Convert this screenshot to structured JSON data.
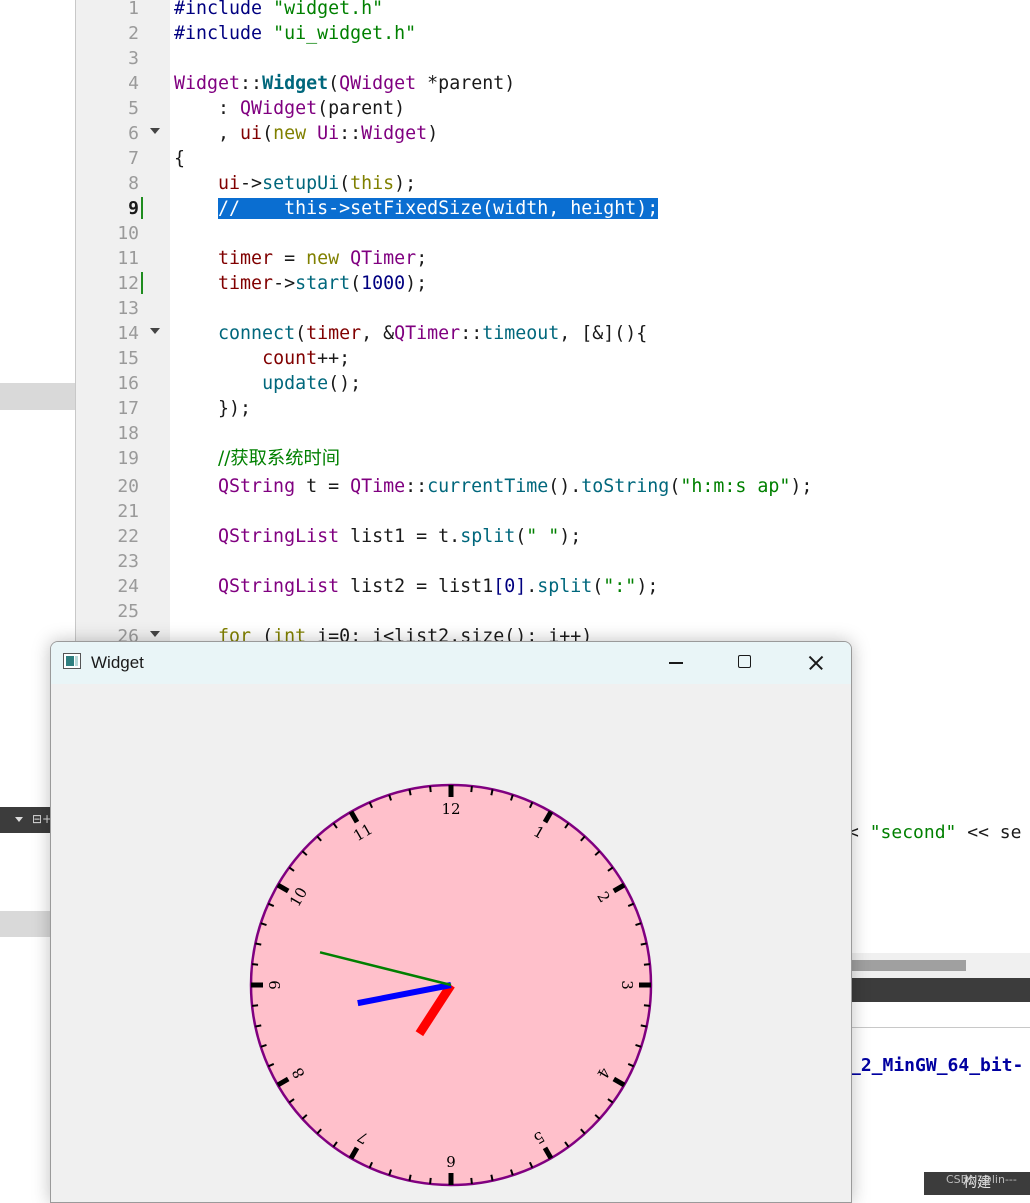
{
  "editor": {
    "lines": [
      {
        "n": "1"
      },
      {
        "n": "2"
      },
      {
        "n": "3"
      },
      {
        "n": "4"
      },
      {
        "n": "5"
      },
      {
        "n": "6"
      },
      {
        "n": "7"
      },
      {
        "n": "8"
      },
      {
        "n": "9"
      },
      {
        "n": "10"
      },
      {
        "n": "11"
      },
      {
        "n": "12"
      },
      {
        "n": "13"
      },
      {
        "n": "14"
      },
      {
        "n": "15"
      },
      {
        "n": "16"
      },
      {
        "n": "17"
      },
      {
        "n": "18"
      },
      {
        "n": "19"
      },
      {
        "n": "20"
      },
      {
        "n": "21"
      },
      {
        "n": "22"
      },
      {
        "n": "23"
      },
      {
        "n": "24"
      },
      {
        "n": "25"
      },
      {
        "n": "26"
      }
    ],
    "code": {
      "l1_pp": "#include ",
      "l1_str": "\"widget.h\"",
      "l2_pp": "#include ",
      "l2_str": "\"ui_widget.h\"",
      "l4_ty": "Widget",
      "l4_sep": "::",
      "l4_fn": "Widget",
      "l4_open": "(",
      "l4_ty2": "QWidget",
      "l4_rest": " *parent)",
      "l5_pre": "    : ",
      "l5_ty": "QWidget",
      "l5_rest": "(parent)",
      "l6_pre": "    , ",
      "l6_var": "ui",
      "l6_open": "(",
      "l6_kw": "new",
      "l6_sp": " ",
      "l6_ty": "Ui",
      "l6_sep": "::",
      "l6_ty2": "Widget",
      "l6_close": ")",
      "l7": "{",
      "l8_pre": "    ",
      "l8_var": "ui",
      "l8_arrow": "->",
      "l8_fn": "setupUi",
      "l8_open": "(",
      "l8_kw": "this",
      "l8_close": ");",
      "l9_pre": "    ",
      "l9_sel": "//    this->setFixedSize(width, height);",
      "l11_pre": "    ",
      "l11_var": "timer",
      "l11_eq": " = ",
      "l11_kw": "new",
      "l11_sp": " ",
      "l11_ty": "QTimer",
      "l11_end": ";",
      "l12_pre": "    ",
      "l12_var": "timer",
      "l12_arrow": "->",
      "l12_fn": "start",
      "l12_open": "(",
      "l12_num": "1000",
      "l12_close": ");",
      "l14_pre": "    ",
      "l14_fn": "connect",
      "l14_open": "(",
      "l14_var": "timer",
      "l14_c": ", &",
      "l14_ty": "QTimer",
      "l14_sep": "::",
      "l14_fn2": "timeout",
      "l14_rest": ", [&](){",
      "l15_pre": "        ",
      "l15_var": "count",
      "l15_rest": "++;",
      "l16_pre": "        ",
      "l16_fn": "update",
      "l16_rest": "();",
      "l17": "    });",
      "l19_pre": "    ",
      "l19_cm": "//获取系统时间",
      "l20_pre": "    ",
      "l20_ty": "QString",
      "l20_t": " t = ",
      "l20_ty2": "QTime",
      "l20_sep": "::",
      "l20_fn": "currentTime",
      "l20_m": "().",
      "l20_fn2": "toString",
      "l20_open": "(",
      "l20_str": "\"h:m:s ap\"",
      "l20_close": ");",
      "l22_pre": "    ",
      "l22_ty": "QStringList",
      "l22_m": " list1 = t.",
      "l22_fn": "split",
      "l22_open": "(",
      "l22_str": "\" \"",
      "l22_close": ");",
      "l24_pre": "    ",
      "l24_ty": "QStringList",
      "l24_m": " list2 = list1",
      "l24_idx": "[0]",
      "l24_dot": ".",
      "l24_fn": "split",
      "l24_open": "(",
      "l24_str": "\":\"",
      "l24_close": ");",
      "l26_pre": "    ",
      "l26_kw": "for",
      "l26_m": " (",
      "l26_kw2": "int",
      "l26_rest": " i=0; i<list2.size(); i++)"
    }
  },
  "background": {
    "frag_second_pre": "< ",
    "frag_second_str": "\"second\"",
    "frag_second_post": " << se",
    "frag_kit": "_2_MinGW_64_bit-",
    "build_label": "构建",
    "watermark": "CSDN @lin---"
  },
  "window": {
    "title": "Widget",
    "clock": {
      "numbers": [
        "12",
        "1",
        "2",
        "3",
        "4",
        "5",
        "6",
        "7",
        "8",
        "9",
        "10",
        "11"
      ],
      "face_color": "#ffc0cb",
      "rim_color": "#800080",
      "hour_hand_color": "#ff0000",
      "minute_hand_color": "#0000ff",
      "second_hand_color": "#008000",
      "hour_hand_angle_deg": 213,
      "minute_hand_angle_deg": 259,
      "second_hand_angle_deg": 284
    }
  }
}
